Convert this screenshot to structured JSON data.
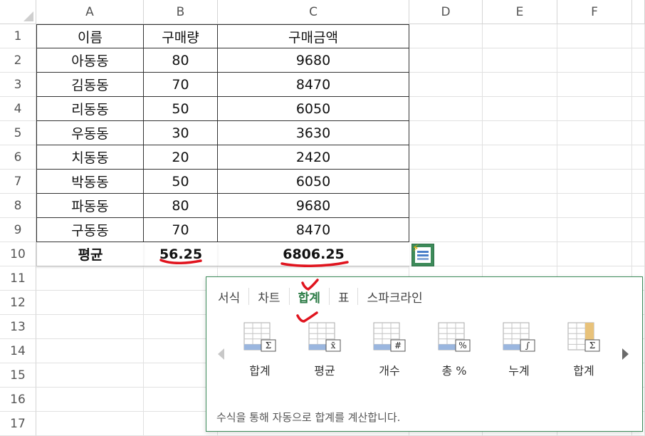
{
  "columns": [
    "A",
    "B",
    "C",
    "D",
    "E",
    "F"
  ],
  "rows": [
    "1",
    "2",
    "3",
    "4",
    "5",
    "6",
    "7",
    "8",
    "9",
    "10",
    "11",
    "12",
    "13",
    "14",
    "15",
    "16",
    "17"
  ],
  "table": {
    "header": [
      "이름",
      "구매량",
      "구매금액"
    ],
    "data": [
      [
        "아동동",
        "80",
        "9680"
      ],
      [
        "김동동",
        "70",
        "8470"
      ],
      [
        "리동동",
        "50",
        "6050"
      ],
      [
        "우동동",
        "30",
        "3630"
      ],
      [
        "치동동",
        "20",
        "2420"
      ],
      [
        "박동동",
        "50",
        "6050"
      ],
      [
        "파동동",
        "80",
        "9680"
      ],
      [
        "구동동",
        "70",
        "8470"
      ]
    ],
    "footer": [
      "평균",
      "56.25",
      "6806.25"
    ]
  },
  "quick_analysis": {
    "tabs": [
      "서식",
      "차트",
      "합계",
      "표",
      "스파크라인"
    ],
    "active_tab": "합계",
    "items": [
      {
        "label": "합계",
        "icon": "sum-icon"
      },
      {
        "label": "평균",
        "icon": "average-icon"
      },
      {
        "label": "개수",
        "icon": "count-icon"
      },
      {
        "label": "총 %",
        "icon": "percent-total-icon"
      },
      {
        "label": "누계",
        "icon": "running-total-icon"
      },
      {
        "label": "합계",
        "icon": "sum-column-icon"
      }
    ],
    "description": "수식을 통해 자동으로 합계를 계산합니다."
  },
  "colors": {
    "accent_green": "#2a7a44",
    "annotation_red": "#e0141e",
    "icon_blue": "#9ab6df"
  }
}
